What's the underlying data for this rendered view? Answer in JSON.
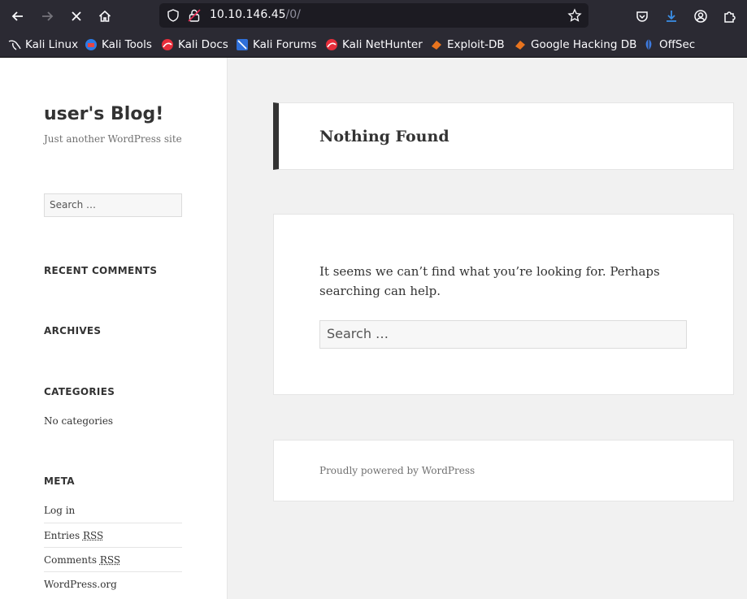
{
  "browser": {
    "url_host": "10.10.146.45",
    "url_path": "/0/",
    "bookmarks": [
      {
        "label": "Kali Linux",
        "icon": "kali-dragon-icon"
      },
      {
        "label": "Kali Tools",
        "icon": "kali-tools-icon"
      },
      {
        "label": "Kali Docs",
        "icon": "kali-docs-icon"
      },
      {
        "label": "Kali Forums",
        "icon": "kali-forums-icon"
      },
      {
        "label": "Kali NetHunter",
        "icon": "kali-nethunter-icon"
      },
      {
        "label": "Exploit-DB",
        "icon": "exploit-db-icon"
      },
      {
        "label": "Google Hacking DB",
        "icon": "ghdb-icon"
      },
      {
        "label": "OffSec",
        "icon": "offsec-icon"
      }
    ],
    "colors": {
      "chrome": "#2b2a33",
      "urlbar": "#1c1b22",
      "download_accent": "#3a8ee6"
    }
  },
  "sidebar": {
    "site_title": "user's Blog!",
    "site_description": "Just another WordPress site",
    "search_placeholder": "Search …",
    "recent_comments_title": "RECENT COMMENTS",
    "archives_title": "ARCHIVES",
    "categories_title": "CATEGORIES",
    "categories_empty": "No categories",
    "meta_title": "META",
    "meta_links": {
      "login": "Log in",
      "entries_prefix": "Entries",
      "comments_prefix": "Comments",
      "rss": "RSS",
      "wordpress_org": "WordPress.org"
    }
  },
  "main": {
    "not_found_title": "Nothing Found",
    "not_found_text": "It seems we can’t find what you’re looking for. Perhaps search­ing can help.",
    "search_placeholder": "Search …",
    "footer_text": "Proudly powered by WordPress"
  }
}
